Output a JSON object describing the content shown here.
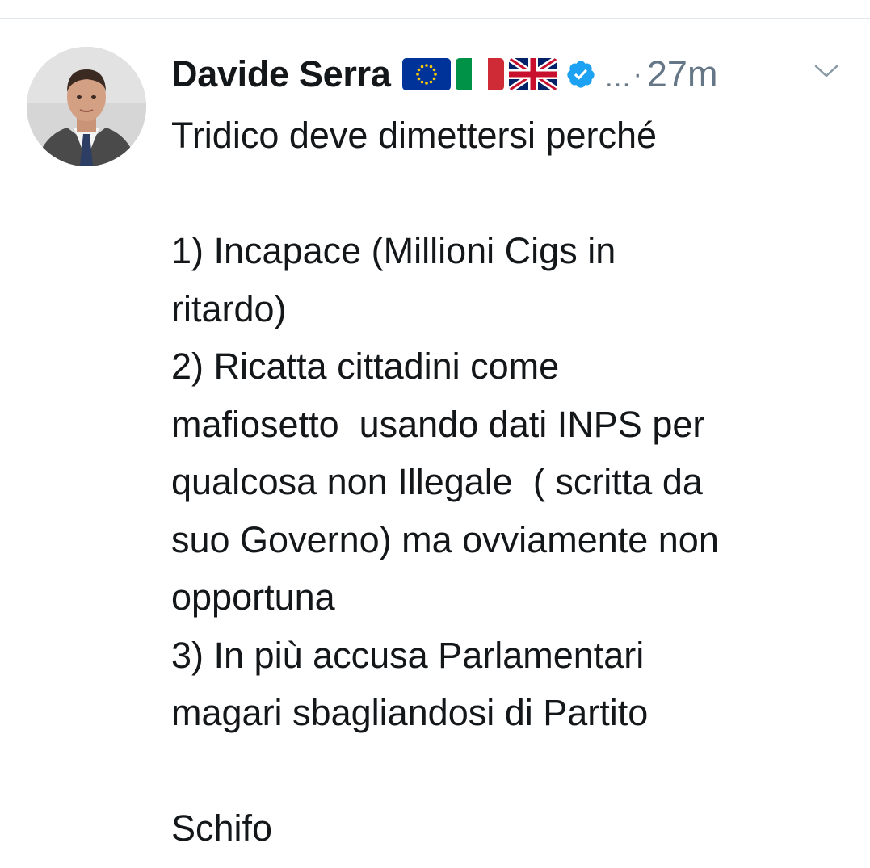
{
  "tweet": {
    "author": {
      "display_name": "Davide Serra",
      "flag_icons": [
        "eu-flag-icon",
        "italy-flag-icon",
        "uk-flag-icon"
      ],
      "verified": true
    },
    "overflow_text": "…",
    "separator": "·",
    "timestamp": "27m",
    "menu_icon": "chevron-down-icon",
    "lines": [
      "Tridico deve dimettersi perché",
      "",
      "1) Incapace (Millioni Cigs in",
      "ritardo)",
      "2) Ricatta cittadini come",
      "mafiosetto  usando dati INPS per",
      "qualcosa non Illegale  ( scritta da",
      "suo Governo) ma ovviamente non",
      "opportuna",
      "3) In più accusa Parlamentari",
      "magari sbagliandosi di Partito",
      "",
      "Schifo"
    ]
  },
  "colors": {
    "text": "#14171a",
    "muted": "#657786",
    "verified_blue": "#1da1f2",
    "divider": "#e1e8ed"
  }
}
